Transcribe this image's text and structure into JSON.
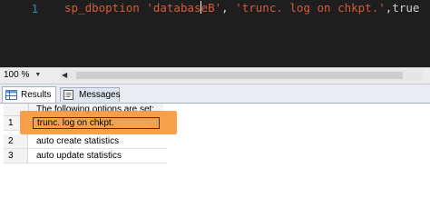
{
  "editor": {
    "line_number": "1",
    "code": {
      "keyword": "sp_dboption",
      "db_part1": "'databas",
      "db_part2": "eB'",
      "comma1": ", ",
      "option": "'trunc. log on chkpt.'",
      "comma2": ",",
      "value": "true"
    }
  },
  "zoom": {
    "value": "100 %",
    "dropdown_icon": "chevron-down-icon"
  },
  "tabs": [
    {
      "label": "Results",
      "icon": "grid-icon",
      "active": true
    },
    {
      "label": "Messages",
      "icon": "messages-icon",
      "active": false
    }
  ],
  "grid": {
    "column_header": "The following options are set:",
    "rows": [
      {
        "num": "1",
        "value": "trunc. log on chkpt."
      },
      {
        "num": "2",
        "value": "auto create statistics"
      },
      {
        "num": "3",
        "value": "auto update statistics"
      }
    ]
  },
  "colors": {
    "editor_bg": "#1e1e1e",
    "code_accent": "#d85a38",
    "highlight": "#f79434"
  }
}
